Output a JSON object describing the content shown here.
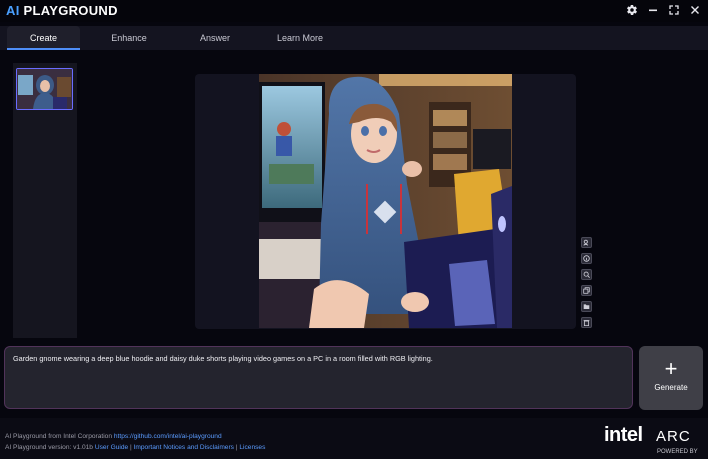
{
  "app": {
    "title_prefix": "AI",
    "title_rest": " PLAYGROUND"
  },
  "window_controls": {
    "settings_icon": "gear-icon",
    "minimize_icon": "minimize-icon",
    "maximize_icon": "maximize-icon",
    "close_icon": "close-icon"
  },
  "tabs": [
    {
      "label": "Create",
      "active": true
    },
    {
      "label": "Enhance",
      "active": false
    },
    {
      "label": "Answer",
      "active": false
    },
    {
      "label": "Learn More",
      "active": false
    }
  ],
  "image_tools": [
    "image-info-icon",
    "info-icon",
    "search-icon",
    "copy-icon",
    "folder-icon",
    "trash-icon"
  ],
  "prompt": {
    "text": "Garden gnome wearing a deep blue hoodie and daisy duke shorts playing video games on a PC in a room filled with RGB lighting."
  },
  "generate": {
    "plus": "+",
    "label": "Generate"
  },
  "footer": {
    "line1_text": "AI Playground from Intel Corporation ",
    "line1_link": "https://github.com/intel/ai-playground",
    "line2_text": "AI Playground version: v1.01b ",
    "user_guide": "User Guide",
    "sep": " | ",
    "notices": "Important Notices and Disclaimers",
    "licenses": "Licenses"
  },
  "brand": {
    "intel": "intel",
    "arc": "ARC",
    "powered": "POWERED BY"
  },
  "colors": {
    "accent_blue": "#4f8ef7",
    "link_blue": "#5b9cff",
    "prompt_border": "#51335a",
    "background": "#06060e"
  }
}
